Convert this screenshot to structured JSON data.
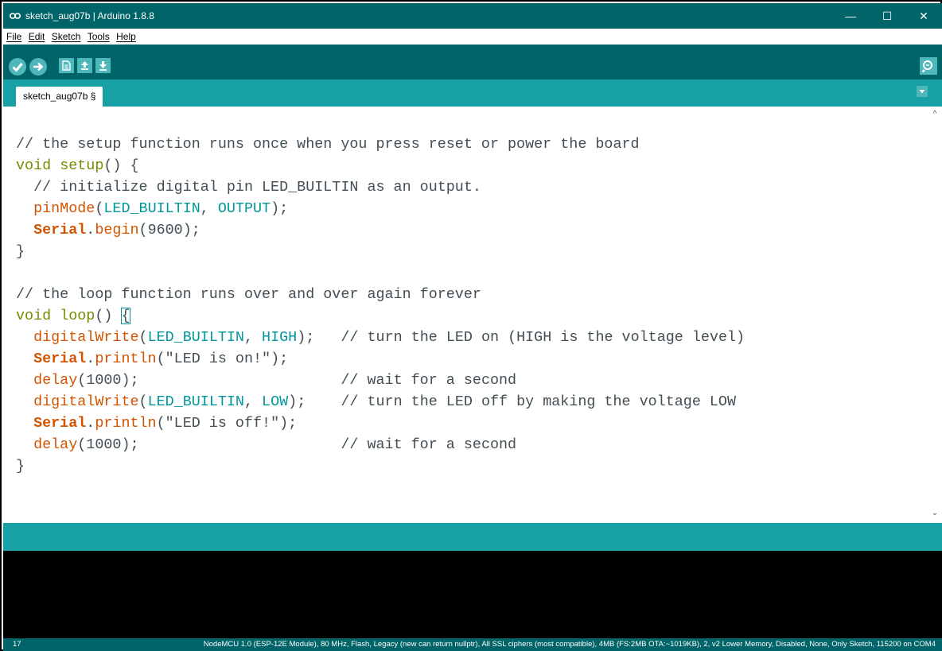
{
  "window": {
    "title": "sketch_aug07b | Arduino 1.8.8",
    "minimize": "—",
    "maximize": "☐",
    "close": "✕"
  },
  "menu": [
    "File",
    "Edit",
    "Sketch",
    "Tools",
    "Help"
  ],
  "toolbar": {
    "buttons": [
      "verify-icon",
      "upload-icon",
      "new-icon",
      "open-icon",
      "save-icon"
    ],
    "serial_monitor": "serial-monitor-icon"
  },
  "tabs": [
    {
      "label": "sketch_aug07b §"
    }
  ],
  "colors": {
    "accent_dark": "#006468",
    "accent_light": "#17a1a5",
    "button_fill": "#4db7bb",
    "keyword": "#728e00",
    "function": "#d35400",
    "constant": "#00979c",
    "comment": "#434f54"
  },
  "code": {
    "lines": [
      [
        {
          "t": "// the setup function runs once when you press reset or power the board",
          "c": "cm"
        }
      ],
      [
        {
          "t": "void",
          "c": "kw"
        },
        {
          "t": " "
        },
        {
          "t": "setup",
          "c": "kw"
        },
        {
          "t": "() {"
        }
      ],
      [
        {
          "t": "  // initialize digital pin LED_BUILTIN as an output.",
          "c": "cm"
        }
      ],
      [
        {
          "t": "  "
        },
        {
          "t": "pinMode",
          "c": "fn"
        },
        {
          "t": "("
        },
        {
          "t": "LED_BUILTIN",
          "c": "cst"
        },
        {
          "t": ", "
        },
        {
          "t": "OUTPUT",
          "c": "cst"
        },
        {
          "t": ");"
        }
      ],
      [
        {
          "t": "  "
        },
        {
          "t": "Serial",
          "c": "cls"
        },
        {
          "t": "."
        },
        {
          "t": "begin",
          "c": "fn"
        },
        {
          "t": "(9600);"
        }
      ],
      [
        {
          "t": "}"
        }
      ],
      [
        {
          "t": ""
        }
      ],
      [
        {
          "t": "// the loop function runs over and over again forever",
          "c": "cm"
        }
      ],
      [
        {
          "t": "void",
          "c": "kw"
        },
        {
          "t": " "
        },
        {
          "t": "loop",
          "c": "kw"
        },
        {
          "t": "() "
        },
        {
          "t": "{",
          "c": "brace"
        }
      ],
      [
        {
          "t": "  "
        },
        {
          "t": "digitalWrite",
          "c": "fn"
        },
        {
          "t": "("
        },
        {
          "t": "LED_BUILTIN",
          "c": "cst"
        },
        {
          "t": ", "
        },
        {
          "t": "HIGH",
          "c": "cst"
        },
        {
          "t": ");   "
        },
        {
          "t": "// turn the LED on (HIGH is the voltage level)",
          "c": "cm"
        }
      ],
      [
        {
          "t": "  "
        },
        {
          "t": "Serial",
          "c": "cls"
        },
        {
          "t": "."
        },
        {
          "t": "println",
          "c": "fn"
        },
        {
          "t": "(\"LED is on!\");"
        }
      ],
      [
        {
          "t": "  "
        },
        {
          "t": "delay",
          "c": "fn"
        },
        {
          "t": "(1000);                       "
        },
        {
          "t": "// wait for a second",
          "c": "cm"
        }
      ],
      [
        {
          "t": "  "
        },
        {
          "t": "digitalWrite",
          "c": "fn"
        },
        {
          "t": "("
        },
        {
          "t": "LED_BUILTIN",
          "c": "cst"
        },
        {
          "t": ", "
        },
        {
          "t": "LOW",
          "c": "cst"
        },
        {
          "t": ");    "
        },
        {
          "t": "// turn the LED off by making the voltage LOW",
          "c": "cm"
        }
      ],
      [
        {
          "t": "  "
        },
        {
          "t": "Serial",
          "c": "cls"
        },
        {
          "t": "."
        },
        {
          "t": "println",
          "c": "fn"
        },
        {
          "t": "(\"LED is off!\");"
        }
      ],
      [
        {
          "t": "  "
        },
        {
          "t": "delay",
          "c": "fn"
        },
        {
          "t": "(1000);                       "
        },
        {
          "t": "// wait for a second",
          "c": "cm"
        }
      ],
      [
        {
          "t": "}"
        }
      ]
    ]
  },
  "status": {
    "line_number": "17",
    "board": "NodeMCU 1.0 (ESP-12E Module), 80 MHz, Flash, Legacy (new can return nullptr), All SSL ciphers (most compatible), 4MB (FS:2MB OTA:~1019KB), 2, v2 Lower Memory, Disabled, None, Only Sketch, 115200 on COM4"
  }
}
